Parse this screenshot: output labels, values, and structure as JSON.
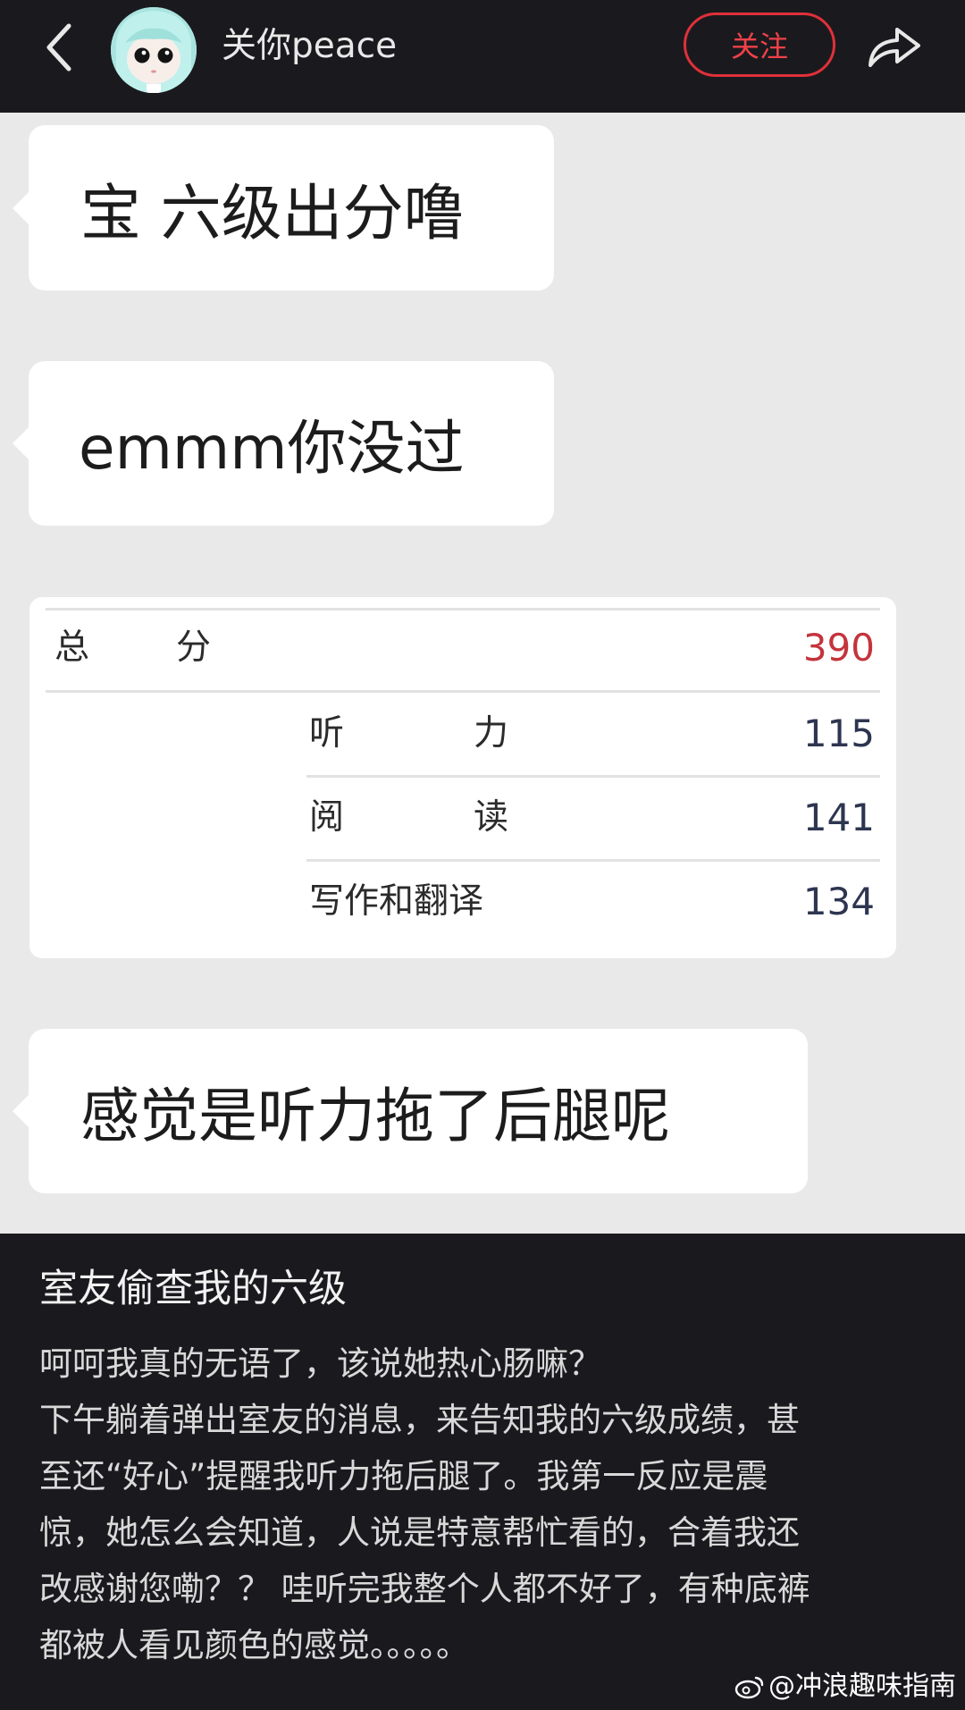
{
  "header": {
    "username": "关你peace",
    "follow_label": "关注",
    "icons": {
      "back": "chevron-left-icon",
      "share": "share-arrow-icon"
    }
  },
  "chat": {
    "messages": [
      {
        "text": "宝 六级出分噜"
      },
      {
        "text": "emmm你没过"
      },
      {
        "text": "感觉是听力拖了后腿呢"
      }
    ],
    "score": {
      "total_label_1": "总",
      "total_label_2": "分",
      "total_value": "390",
      "rows": [
        {
          "label_1": "听",
          "label_2": "力",
          "value": "115"
        },
        {
          "label_1": "阅",
          "label_2": "读",
          "value": "141"
        },
        {
          "label": "写作和翻译",
          "value": "134"
        }
      ]
    }
  },
  "post": {
    "title": "室友偷查我的六级",
    "lines": [
      "呵呵我真的无语了，该说她热心肠嘛？",
      "下午躺着弹出室友的消息，来告知我的六级成绩，甚",
      "至还“好心”提醒我听力拖后腿了。我第一反应是震",
      "惊，她怎么会知道，人说是特意帮忙看的，合着我还",
      "改感谢您嘞？？ 哇听完我整个人都不好了，有种底裤",
      "都被人看见颜色的感觉。。。。。"
    ]
  },
  "watermark": "@冲浪趣味指南",
  "colors": {
    "follow_border": "#e0303a",
    "total_score": "#c4343c",
    "dark_bg": "#1a1a1e",
    "chat_bg": "#e9e9e9"
  }
}
